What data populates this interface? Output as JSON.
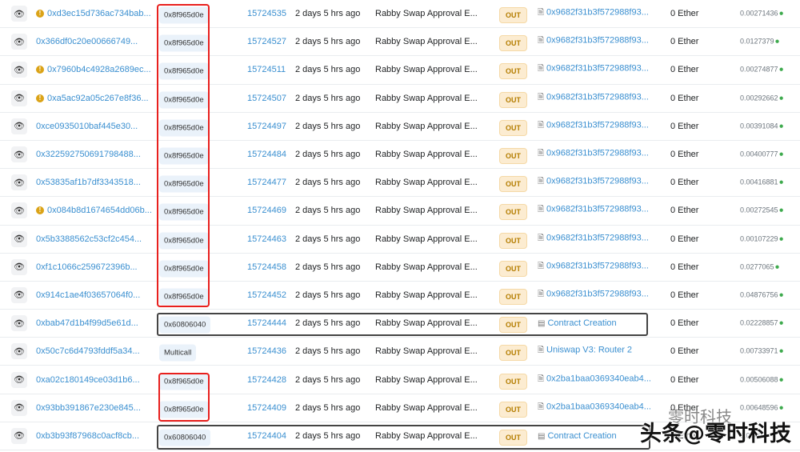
{
  "direction_label": "OUT",
  "rows": [
    {
      "warn": true,
      "hash": "0xd3ec15d736ac734bab...",
      "method": "0x8f965d0e",
      "block": "15724535",
      "age": "2 days 5 hrs ago",
      "from": "Rabby Swap Approval E...",
      "to": "0x9682f31b3f572988f93...",
      "to_type": "contract",
      "value": "0 Ether",
      "fee": "0.00271436"
    },
    {
      "warn": false,
      "hash": "0x366df0c20e00666749...",
      "method": "0x8f965d0e",
      "block": "15724527",
      "age": "2 days 5 hrs ago",
      "from": "Rabby Swap Approval E...",
      "to": "0x9682f31b3f572988f93...",
      "to_type": "contract",
      "value": "0 Ether",
      "fee": "0.0127379"
    },
    {
      "warn": true,
      "hash": "0x7960b4c4928a2689ec...",
      "method": "0x8f965d0e",
      "block": "15724511",
      "age": "2 days 5 hrs ago",
      "from": "Rabby Swap Approval E...",
      "to": "0x9682f31b3f572988f93...",
      "to_type": "contract",
      "value": "0 Ether",
      "fee": "0.00274877"
    },
    {
      "warn": true,
      "hash": "0xa5ac92a05c267e8f36...",
      "method": "0x8f965d0e",
      "block": "15724507",
      "age": "2 days 5 hrs ago",
      "from": "Rabby Swap Approval E...",
      "to": "0x9682f31b3f572988f93...",
      "to_type": "contract",
      "value": "0 Ether",
      "fee": "0.00292662"
    },
    {
      "warn": false,
      "hash": "0xce0935010baf445e30...",
      "method": "0x8f965d0e",
      "block": "15724497",
      "age": "2 days 5 hrs ago",
      "from": "Rabby Swap Approval E...",
      "to": "0x9682f31b3f572988f93...",
      "to_type": "contract",
      "value": "0 Ether",
      "fee": "0.00391084"
    },
    {
      "warn": false,
      "hash": "0x322592750691798488...",
      "method": "0x8f965d0e",
      "block": "15724484",
      "age": "2 days 5 hrs ago",
      "from": "Rabby Swap Approval E...",
      "to": "0x9682f31b3f572988f93...",
      "to_type": "contract",
      "value": "0 Ether",
      "fee": "0.00400777"
    },
    {
      "warn": false,
      "hash": "0x53835af1b7df3343518...",
      "method": "0x8f965d0e",
      "block": "15724477",
      "age": "2 days 5 hrs ago",
      "from": "Rabby Swap Approval E...",
      "to": "0x9682f31b3f572988f93...",
      "to_type": "contract",
      "value": "0 Ether",
      "fee": "0.00416881"
    },
    {
      "warn": true,
      "hash": "0x084b8d1674654dd06b...",
      "method": "0x8f965d0e",
      "block": "15724469",
      "age": "2 days 5 hrs ago",
      "from": "Rabby Swap Approval E...",
      "to": "0x9682f31b3f572988f93...",
      "to_type": "contract",
      "value": "0 Ether",
      "fee": "0.00272545"
    },
    {
      "warn": false,
      "hash": "0x5b3388562c53cf2c454...",
      "method": "0x8f965d0e",
      "block": "15724463",
      "age": "2 days 5 hrs ago",
      "from": "Rabby Swap Approval E...",
      "to": "0x9682f31b3f572988f93...",
      "to_type": "contract",
      "value": "0 Ether",
      "fee": "0.00107229"
    },
    {
      "warn": false,
      "hash": "0xf1c1066c259672396b...",
      "method": "0x8f965d0e",
      "block": "15724458",
      "age": "2 days 5 hrs ago",
      "from": "Rabby Swap Approval E...",
      "to": "0x9682f31b3f572988f93...",
      "to_type": "contract",
      "value": "0 Ether",
      "fee": "0.0277065"
    },
    {
      "warn": false,
      "hash": "0x914c1ae4f03657064f0...",
      "method": "0x8f965d0e",
      "block": "15724452",
      "age": "2 days 5 hrs ago",
      "from": "Rabby Swap Approval E...",
      "to": "0x9682f31b3f572988f93...",
      "to_type": "contract",
      "value": "0 Ether",
      "fee": "0.04876756"
    },
    {
      "warn": false,
      "hash": "0xbab47d1b4f99d5e61d...",
      "method": "0x60806040",
      "block": "15724444",
      "age": "2 days 5 hrs ago",
      "from": "Rabby Swap Approval E...",
      "to": "Contract Creation",
      "to_type": "creation",
      "value": "0 Ether",
      "fee": "0.02228857"
    },
    {
      "warn": false,
      "hash": "0x50c7c6d4793fddf5a34...",
      "method": "Multicall",
      "block": "15724436",
      "age": "2 days 5 hrs ago",
      "from": "Rabby Swap Approval E...",
      "to": "Uniswap V3: Router 2",
      "to_type": "contract",
      "value": "0 Ether",
      "fee": "0.00733971"
    },
    {
      "warn": false,
      "hash": "0xa02c180149ce03d1b6...",
      "method": "0x8f965d0e",
      "block": "15724428",
      "age": "2 days 5 hrs ago",
      "from": "Rabby Swap Approval E...",
      "to": "0x2ba1baa0369340eab4...",
      "to_type": "contract",
      "value": "0 Ether",
      "fee": "0.00506088"
    },
    {
      "warn": false,
      "hash": "0x93bb391867e230e845...",
      "method": "0x8f965d0e",
      "block": "15724409",
      "age": "2 days 5 hrs ago",
      "from": "Rabby Swap Approval E...",
      "to": "0x2ba1baa0369340eab4...",
      "to_type": "contract",
      "value": "0 Ether",
      "fee": "0.00648596"
    },
    {
      "warn": false,
      "hash": "0xb3b93f87968c0acf8cb...",
      "method": "0x60806040",
      "block": "15724404",
      "age": "2 days 5 hrs ago",
      "from": "Rabby Swap Approval E...",
      "to": "Contract Creation",
      "to_type": "creation",
      "value": "0 Ether",
      "fee": "0.0040"
    }
  ],
  "watermark": {
    "text": "头条@零时科技",
    "sub": "零时科技"
  },
  "colors": {
    "link": "#3a8fd0",
    "highlight_red": "#e8201e",
    "highlight_dark": "#444444",
    "out_badge": "#fcecd1"
  }
}
